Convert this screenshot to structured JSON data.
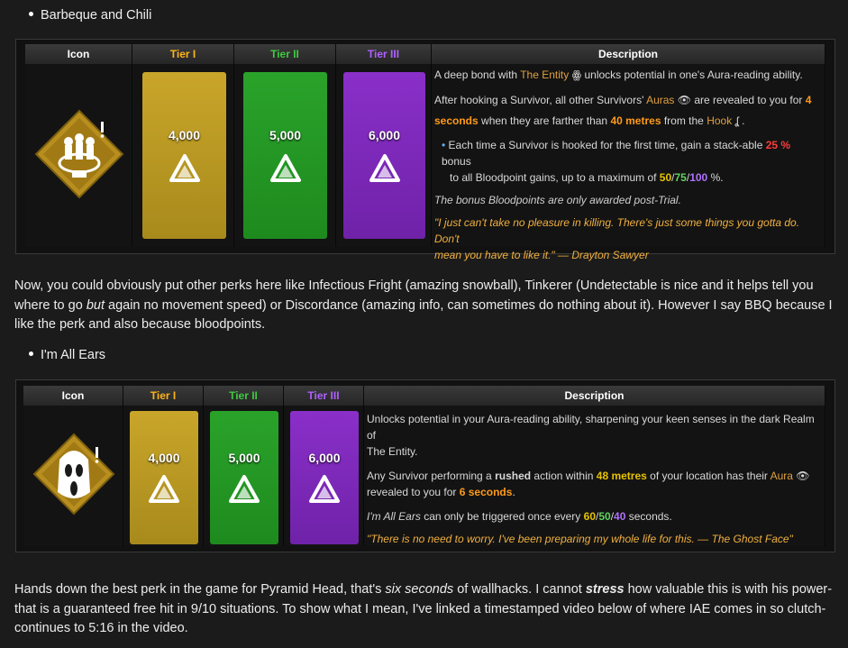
{
  "section1": {
    "bullet": "Barbeque and Chili",
    "headers": {
      "icon": "Icon",
      "tier1": "Tier I",
      "tier2": "Tier II",
      "tier3": "Tier III",
      "desc": "Description"
    },
    "costs": [
      "4,000",
      "5,000",
      "6,000"
    ],
    "desc": {
      "l1a": "A deep bond with ",
      "l1b": "The Entity",
      "l1c": " unlocks potential in one's Aura-reading ability.",
      "l2a": "After hooking a Survivor, all other Survivors' ",
      "l2b": "Auras",
      "l2c": " are revealed to you for ",
      "l2d": "4",
      "l3a": "seconds",
      "l3b": " when they are farther than ",
      "l3c": "40 metres",
      "l3d": " from the ",
      "l3e": "Hook",
      "b1a": "Each time a Survivor is hooked for the first time, gain a stack-able ",
      "b1b": "25 %",
      "b1c": " bonus",
      "b2a": "to all Bloodpoint gains, up to a maximum of ",
      "b2b": "50",
      "b2s1": "/",
      "b2c": "75",
      "b2s2": "/",
      "b2d": "100",
      "b2e": " %.",
      "note": "The bonus Bloodpoints are only awarded post-Trial.",
      "quote1": "\"I just can't take no pleasure in killing. There's just some things you gotta do. Don't",
      "quote2": "mean you have to like it.\" — Drayton Sawyer"
    }
  },
  "paragraph1": {
    "a": "Now, you could obviously put other perks here like Infectious Fright (amazing snowball), Tinkerer (Undetectable is nice and it helps tell you where to go ",
    "b": "but",
    "c": " again no movement speed) or Discordance (amazing info, can sometimes do nothing about it). However I say BBQ because I like the perk and also because bloodpoints."
  },
  "section2": {
    "bullet": "I'm All Ears",
    "headers": {
      "icon": "Icon",
      "tier1": "Tier I",
      "tier2": "Tier II",
      "tier3": "Tier III",
      "desc": "Description"
    },
    "costs": [
      "4,000",
      "5,000",
      "6,000"
    ],
    "desc": {
      "l1": "Unlocks potential in your Aura-reading ability, sharpening your keen senses in the dark Realm of",
      "l2": "The Entity.",
      "l3a": "Any Survivor performing a ",
      "l3b": "rushed",
      "l3c": " action within ",
      "l3d": "48 metres",
      "l3e": " of your location has their ",
      "l3f": "Aura",
      "l4a": "revealed to you for ",
      "l4b": "6 seconds",
      "l4c": ".",
      "l5a": "I'm All Ears",
      "l5b": " can only be triggered once every ",
      "l5c": "60",
      "l5s1": "/",
      "l5d": "50",
      "l5s2": "/",
      "l5e": "40",
      "l5f": " seconds.",
      "quote": "\"There is no need to worry. I've been preparing my whole life for this. — The Ghost Face\""
    }
  },
  "paragraph2": {
    "a": "Hands down the best perk in the game for Pyramid Head, that's ",
    "b": "six seconds",
    "c": " of wallhacks. I cannot ",
    "d": "stress",
    "e": " how valuable this is with his power- that is a guaranteed free hit in 9/10 situations. To show what I mean, I've linked a timestamped video below of where IAE comes in so clutch- continues to 5:16 in the video."
  },
  "colors": {
    "tier1": "#d4b12a",
    "tier2": "#27a827",
    "tier3": "#8a2fc9",
    "accent": "#ff9a1a"
  }
}
